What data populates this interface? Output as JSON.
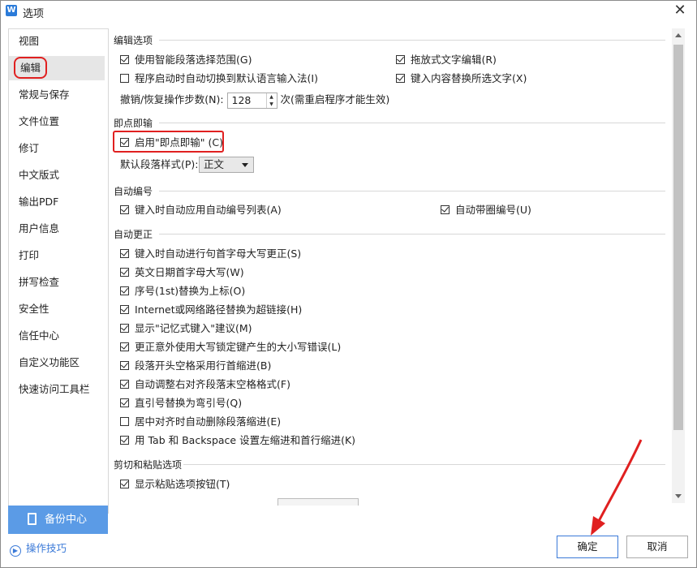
{
  "window": {
    "title": "选项",
    "app_icon": "W"
  },
  "sidebar": {
    "items": [
      {
        "label": "视图"
      },
      {
        "label": "编辑",
        "active": true
      },
      {
        "label": "常规与保存"
      },
      {
        "label": "文件位置"
      },
      {
        "label": "修订"
      },
      {
        "label": "中文版式"
      },
      {
        "label": "输出PDF"
      },
      {
        "label": "用户信息"
      },
      {
        "label": "打印"
      },
      {
        "label": "拼写检查"
      },
      {
        "label": "安全性"
      },
      {
        "label": "信任中心"
      },
      {
        "label": "自定义功能区"
      },
      {
        "label": "快速访问工具栏"
      }
    ],
    "backup_label": "备份中心",
    "tips_label": "操作技巧"
  },
  "edit_options": {
    "title": "编辑选项",
    "smart_para": {
      "label": "使用智能段落选择范围(G)",
      "checked": true
    },
    "drag_drop": {
      "label": "拖放式文字编辑(R)",
      "checked": true
    },
    "auto_switch": {
      "label": "程序启动时自动切换到默认语言输入法(I)",
      "checked": false
    },
    "typing_replace": {
      "label": "键入内容替换所选文字(X)",
      "checked": true
    },
    "undo_label": "撤销/恢复操作步数(N):",
    "undo_value": "128",
    "undo_note": "次(需重启程序才能生效)"
  },
  "click_type": {
    "title": "即点即输",
    "enable": {
      "label": "启用\"即点即输\" (C)",
      "checked": true
    },
    "style_label": "默认段落样式(P):",
    "style_value": "正文"
  },
  "auto_number": {
    "title": "自动编号",
    "apply_list": {
      "label": "键入时自动应用自动编号列表(A)",
      "checked": true
    },
    "circled": {
      "label": "自动带圈编号(U)",
      "checked": true
    }
  },
  "auto_correct": {
    "title": "自动更正",
    "items": [
      {
        "label": "键入时自动进行句首字母大写更正(S)",
        "checked": true
      },
      {
        "label": "英文日期首字母大写(W)",
        "checked": true
      },
      {
        "label": "序号(1st)替换为上标(O)",
        "checked": true
      },
      {
        "label": "Internet或网络路径替换为超链接(H)",
        "checked": true
      },
      {
        "label": "显示\"记忆式键入\"建议(M)",
        "checked": true
      },
      {
        "label": "更正意外使用大写锁定键产生的大小写错误(L)",
        "checked": true
      },
      {
        "label": "段落开头空格采用行首缩进(B)",
        "checked": true
      },
      {
        "label": "自动调整右对齐段落末空格格式(F)",
        "checked": true
      },
      {
        "label": "直引号替换为弯引号(Q)",
        "checked": true
      },
      {
        "label": "居中对齐时自动删除段落缩进(E)",
        "checked": false
      },
      {
        "label": "用 Tab 和 Backspace 设置左缩进和首行缩进(K)",
        "checked": true
      }
    ]
  },
  "cut_paste": {
    "title": "剪切和粘贴选项",
    "show_button": {
      "label": "显示粘贴选项按钮(T)",
      "checked": true
    }
  },
  "buttons": {
    "ok": "确定",
    "cancel": "取消"
  },
  "colors": {
    "accent": "#5b9be6",
    "highlight": "#e02020",
    "link": "#3b7ad8"
  }
}
